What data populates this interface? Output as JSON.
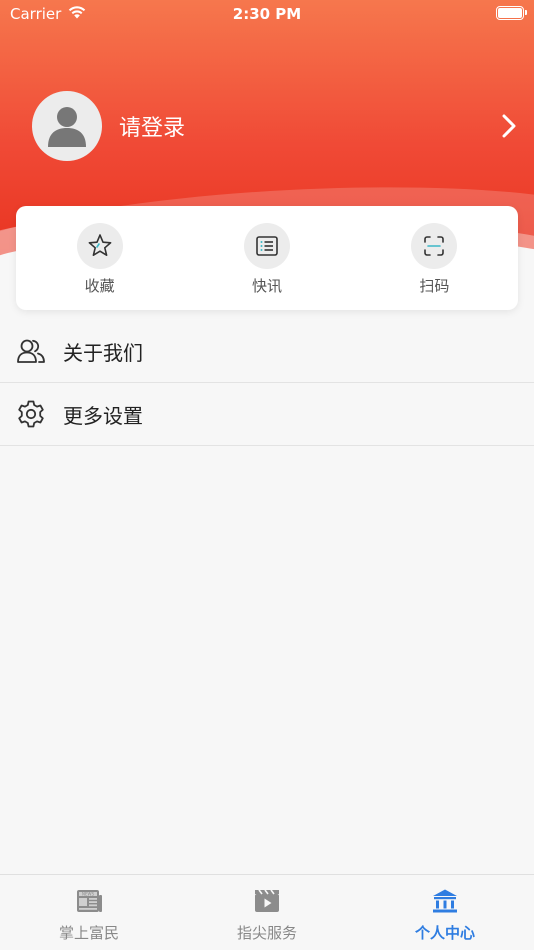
{
  "status_bar": {
    "carrier": "Carrier",
    "time": "2:30 PM"
  },
  "profile": {
    "login_prompt": "请登录"
  },
  "quick_actions": [
    {
      "label": "收藏",
      "icon": "star-icon"
    },
    {
      "label": "快讯",
      "icon": "list-icon"
    },
    {
      "label": "扫码",
      "icon": "scan-icon"
    }
  ],
  "menu": [
    {
      "label": "关于我们",
      "icon": "users-icon"
    },
    {
      "label": "更多设置",
      "icon": "gear-icon"
    }
  ],
  "tabs": [
    {
      "label": "掌上富民",
      "icon": "newspaper-icon",
      "active": false
    },
    {
      "label": "指尖服务",
      "icon": "video-icon",
      "active": false
    },
    {
      "label": "个人中心",
      "icon": "bank-icon",
      "active": true
    }
  ],
  "colors": {
    "header_top": "#f6774d",
    "header_bottom": "#e8321f",
    "active_tab": "#2f7de1",
    "scan_accent": "#3bb7c6"
  }
}
